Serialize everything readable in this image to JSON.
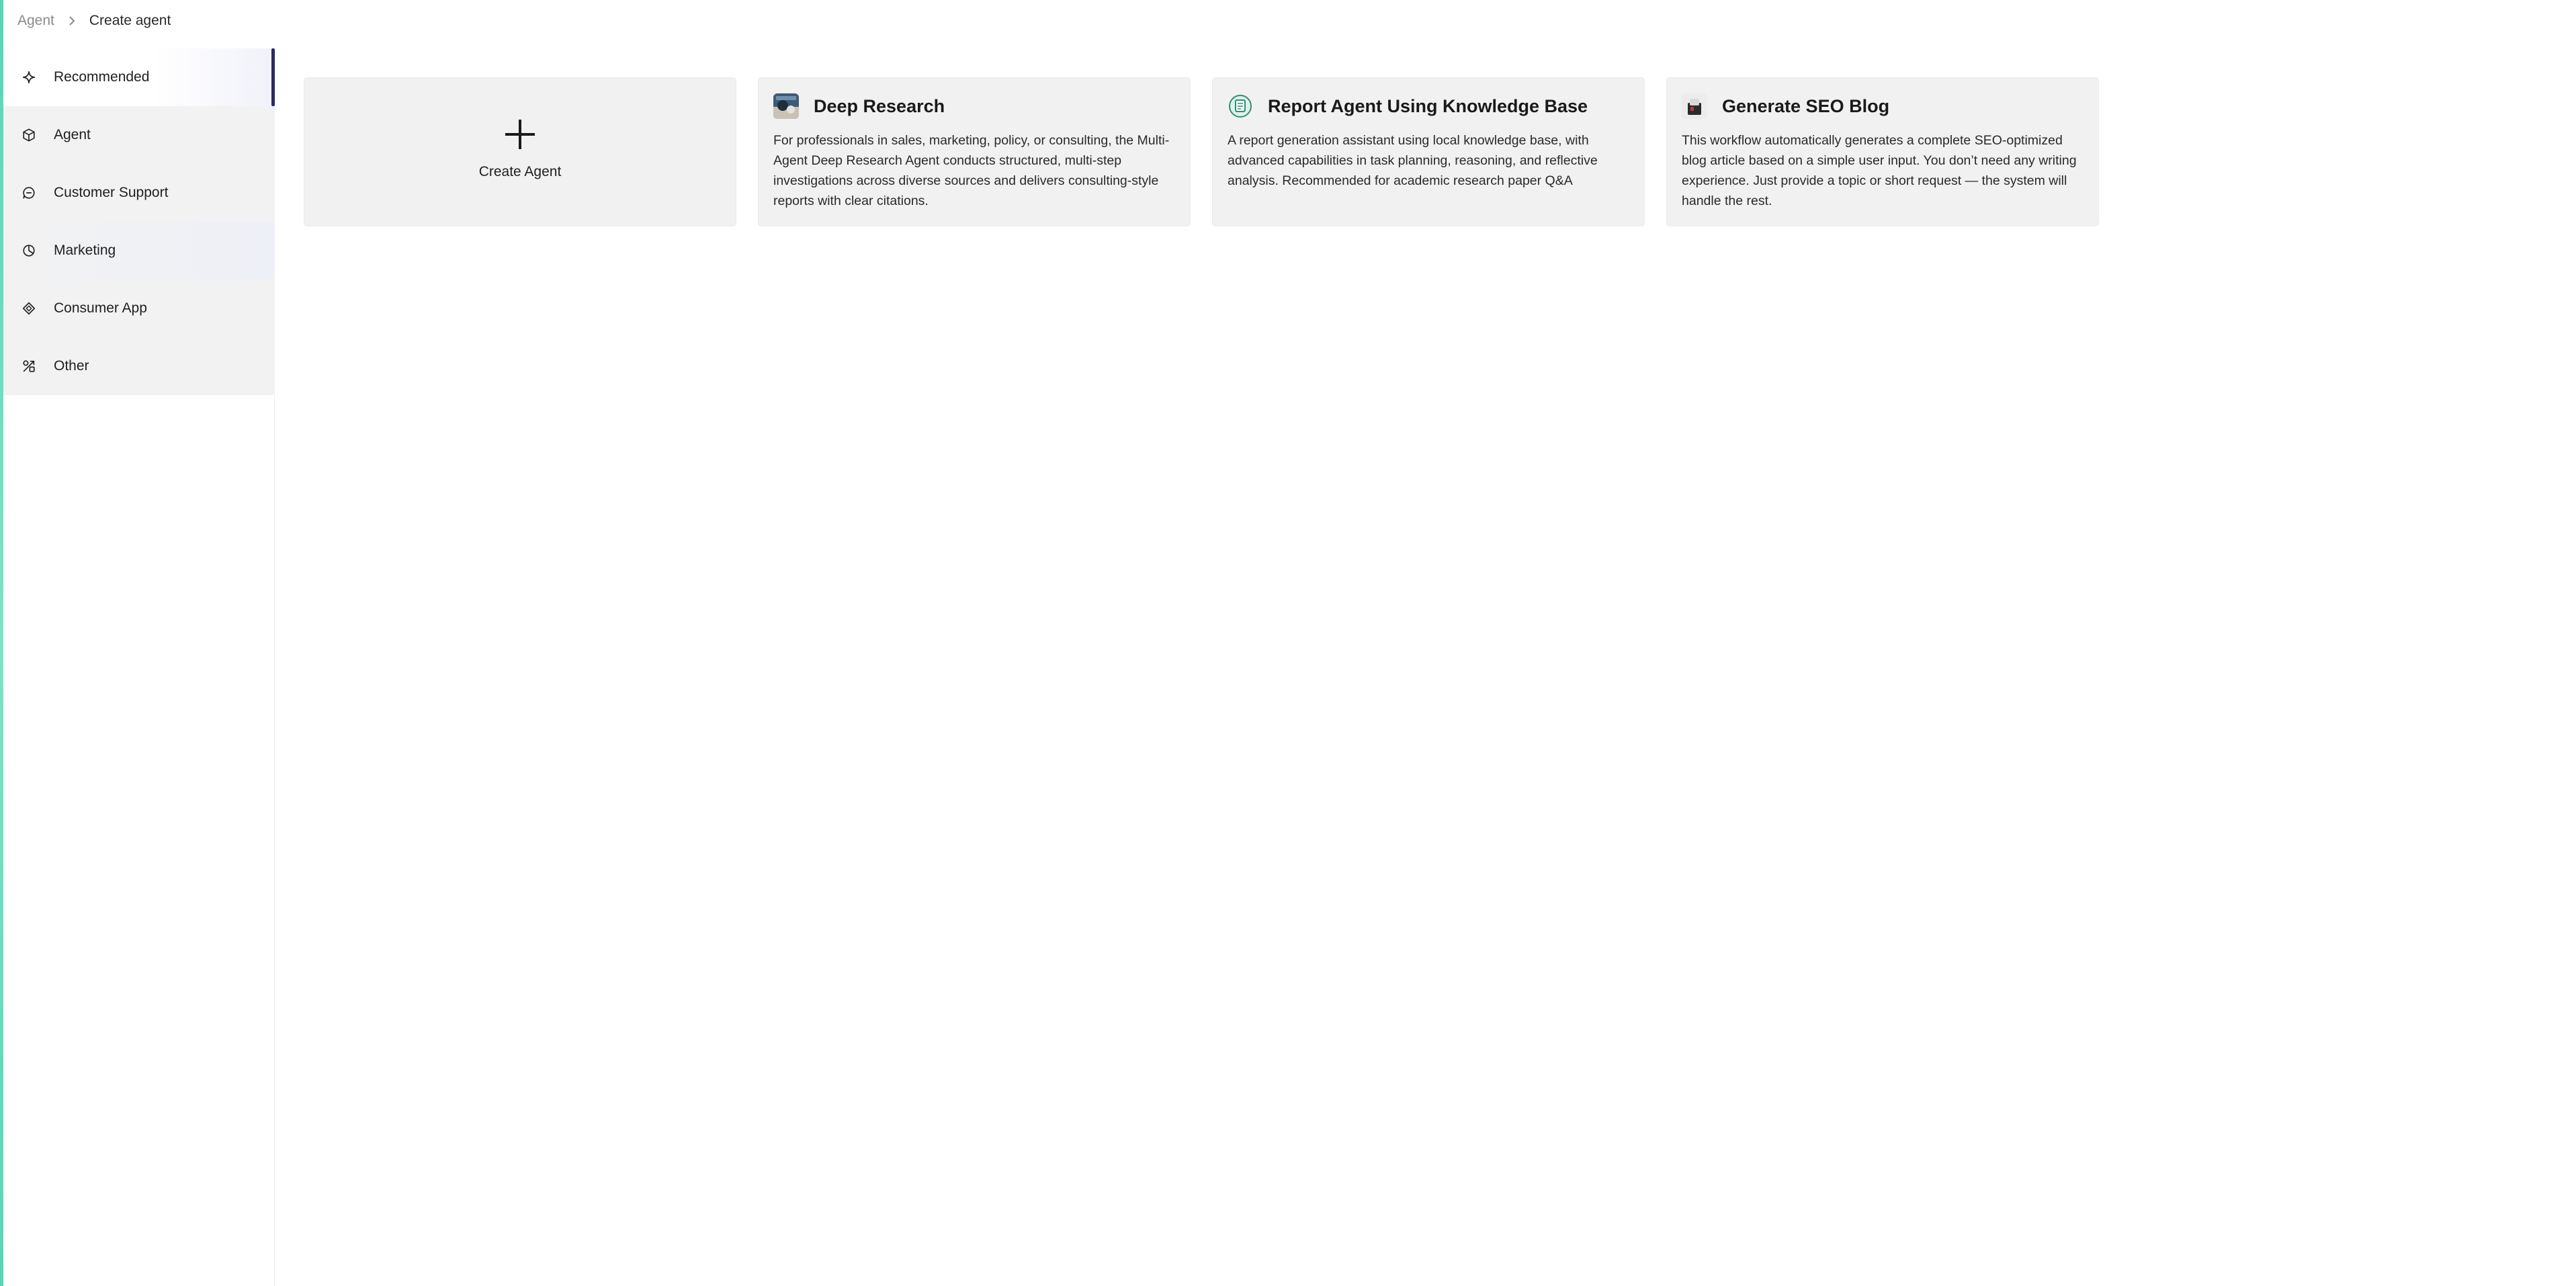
{
  "breadcrumb": {
    "root": "Agent",
    "current": "Create agent"
  },
  "sidebar": {
    "items": [
      {
        "label": "Recommended",
        "icon": "sparkle-icon",
        "active": true
      },
      {
        "label": "Agent",
        "icon": "cube-icon"
      },
      {
        "label": "Customer Support",
        "icon": "chat-bubble-icon"
      },
      {
        "label": "Marketing",
        "icon": "pie-chart-icon"
      },
      {
        "label": "Consumer App",
        "icon": "app-diamond-icon"
      },
      {
        "label": "Other",
        "icon": "shapes-icon"
      }
    ]
  },
  "cards": {
    "create": {
      "label": "Create Agent",
      "icon": "plus-icon"
    },
    "items": [
      {
        "title": "Deep Research",
        "description": "For professionals in sales, marketing, policy, or consulting, the Multi-Agent Deep Research Agent conducts structured, multi-step investigations across diverse sources and delivers consulting-style reports with clear citations.",
        "thumb": "deep-research-thumb"
      },
      {
        "title": "Report Agent Using Knowledge Base",
        "description": "A report generation assistant using local knowledge base, with advanced capabilities in task planning, reasoning, and reflective analysis. Recommended for academic research paper Q&A",
        "thumb": "report-agent-thumb"
      },
      {
        "title": "Generate SEO Blog",
        "description": "This workflow automatically generates a complete SEO-optimized blog article based on a simple user input. You don’t need any writing experience. Just provide a topic or short request — the system will handle the rest.",
        "thumb": "seo-blog-thumb"
      }
    ]
  },
  "colors": {
    "accent_bar": "#58d6b4",
    "active_indicator": "#2a2c5c",
    "card_bg": "#f1f1f1",
    "sidebar_bg": "#f2f2f2"
  }
}
